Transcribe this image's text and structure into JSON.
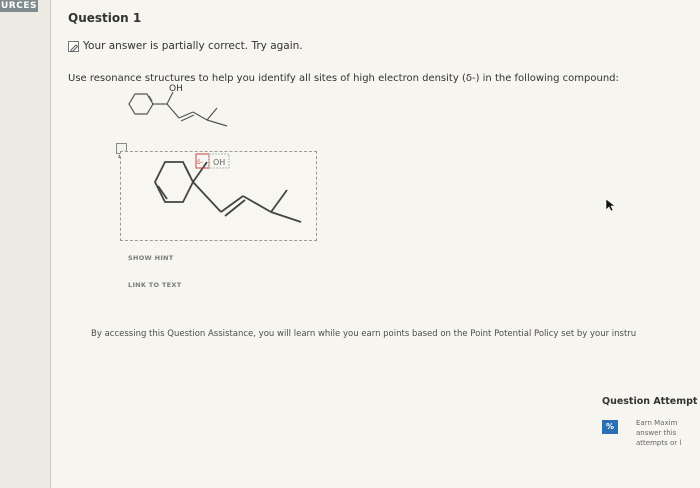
{
  "sidebar": {
    "tab_label": "URCES"
  },
  "question": {
    "title": "Question 1",
    "status": "Your answer is partially correct.  Try again.",
    "prompt": "Use resonance structures to help you identify all sites of high electron density (δ-) in the following compound:",
    "molecule_label": "OH"
  },
  "answer": {
    "oxygen_label": "OH",
    "delta_label": "δ-"
  },
  "buttons": {
    "show_hint": "SHOW HINT",
    "link_to_text": "LINK TO TEXT"
  },
  "assistance_text": "By accessing this Question Assistance, you will learn while you earn points based on the Point Potential Policy set by your instru",
  "attempts": {
    "title": "Question Attempt",
    "badge": "%",
    "earn_lines": [
      "Earn Maxim",
      "answer this",
      "attempts or l"
    ]
  }
}
